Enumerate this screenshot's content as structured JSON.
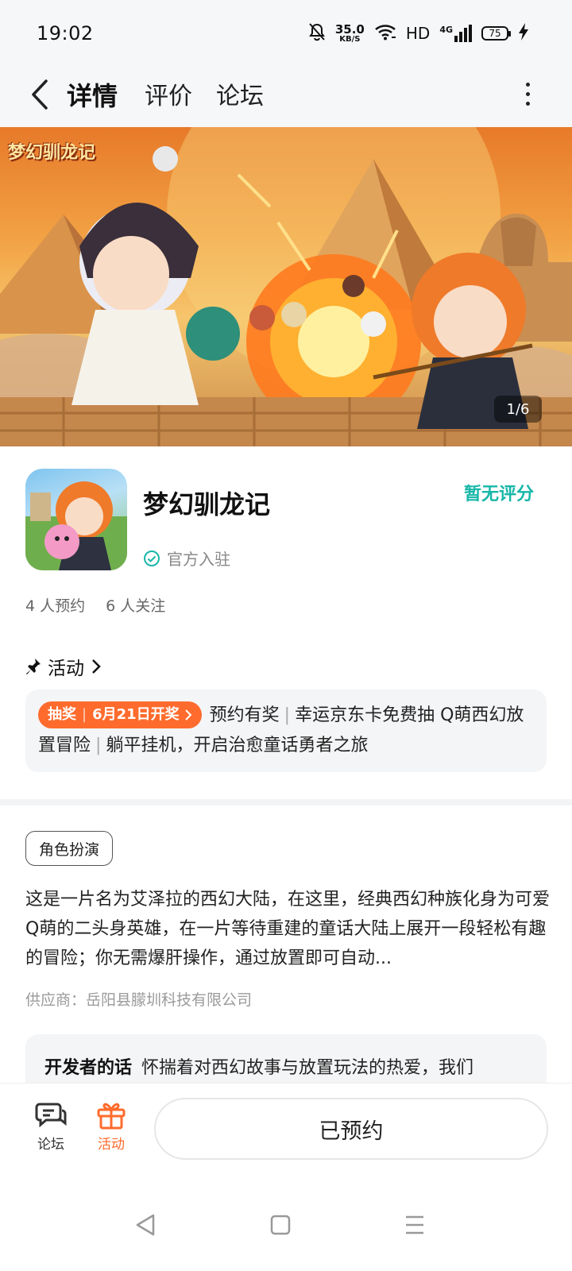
{
  "status_bar": {
    "time": "19:02",
    "net_speed_value": "35.0",
    "net_speed_unit": "KB/S",
    "hd": "HD",
    "signal_type": "4G",
    "battery": "75",
    "icons": [
      "mute-bell-icon",
      "wifi-icon",
      "signal-icon",
      "battery-icon",
      "charging-icon"
    ]
  },
  "nav": {
    "tabs": [
      {
        "label": "详情",
        "active": true
      },
      {
        "label": "评价",
        "active": false
      },
      {
        "label": "论坛",
        "active": false
      }
    ],
    "accent_color": "#17c3b2"
  },
  "banner": {
    "logo_text": "梦幻驯龙记",
    "page_indicator": "1/6"
  },
  "game": {
    "title": "梦幻驯龙记",
    "official_label": "官方入驻",
    "rating_label": "暂无评分",
    "reservations": "4 人预约",
    "followers": "6 人关注"
  },
  "activity": {
    "heading": "活动",
    "tag_type": "抽奖",
    "tag_date": "6月21日开奖",
    "text_part1": "预约有奖",
    "text_part2": "幸运京东卡免费抽 Q萌西幻放置冒险",
    "text_part3": "躺平挂机，开启治愈童话勇者之旅",
    "tag_color": "#ff6b2c"
  },
  "description": {
    "genre_tag": "角色扮演",
    "text": "这是一片名为艾泽拉的西幻大陆，在这里，经典西幻种族化身为可爱Q萌的二头身英雄，在一片等待重建的童话大陆上展开一段轻松有趣的冒险；你无需爆肝操作，通过放置即可自动...",
    "supplier": "供应商：岳阳县朦圳科技有限公司",
    "dev_label": "开发者的话",
    "dev_text": "怀揣着对西幻故事与放置玩法的热爱，我们"
  },
  "bottom_bar": {
    "forum_label": "论坛",
    "activity_label": "活动",
    "reserved_button": "已预约"
  }
}
